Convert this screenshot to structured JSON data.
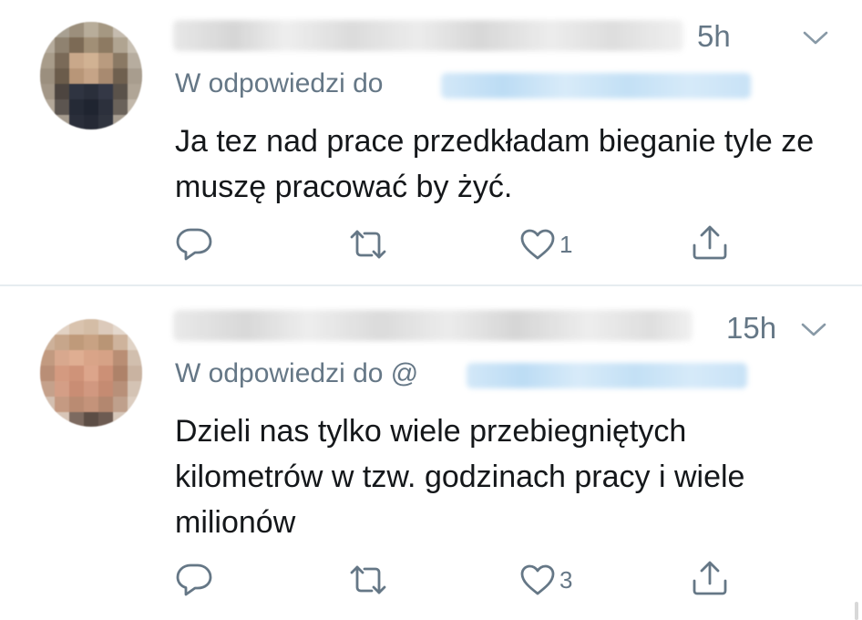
{
  "tweets": [
    {
      "time": "5h",
      "reply_to": "W odpowiedzi do",
      "text": "Ja tez nad prace przedkładam bieganie tyle ze muszę pracować by żyć.",
      "likes": "1",
      "icons": [
        "reply-icon",
        "retweet-icon",
        "like-icon",
        "share-icon",
        "chevron-down-icon"
      ]
    },
    {
      "time": "15h",
      "reply_to": "W odpowiedzi do @",
      "text": "Dzieli nas tylko wiele przebiegniętych kilometrów w tzw. godzinach pracy i wiele milionów",
      "likes": "3",
      "icons": [
        "reply-icon",
        "retweet-icon",
        "like-icon",
        "share-icon",
        "chevron-down-icon"
      ]
    }
  ],
  "colors": {
    "text_primary": "#14171a",
    "text_secondary": "#657786",
    "icon": "#657786",
    "divider": "#e6ecf0",
    "handle_blur": "#c3e0f5"
  }
}
